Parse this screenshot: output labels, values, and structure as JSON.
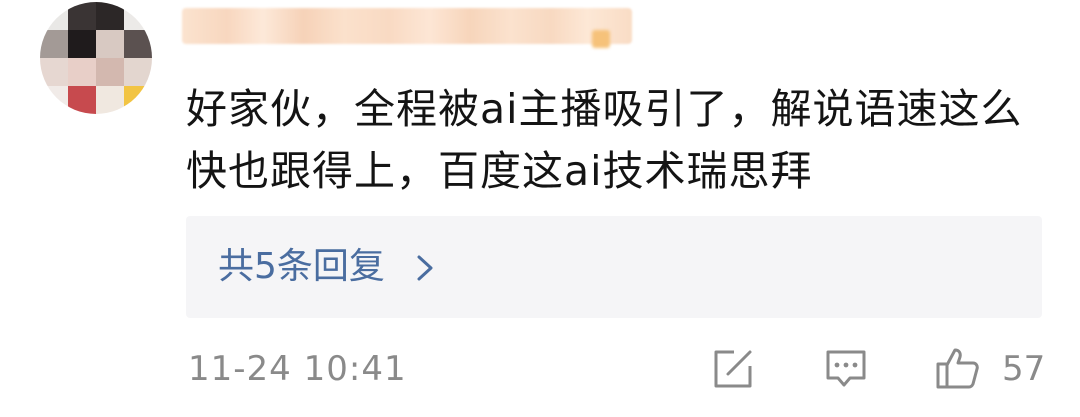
{
  "comment": {
    "text": "好家伙，全程被ai主播吸引了，解说语速这么快也跟得上，百度这ai技术瑞思拜"
  },
  "replies": {
    "label": "共5条回复"
  },
  "footer": {
    "timestamp": "11-24 10:41",
    "like_count": "57"
  },
  "icons": {
    "share": "share-edit-icon",
    "comment": "comment-icon",
    "like": "thumbs-up-icon",
    "chevron": "chevron-right-icon"
  },
  "colors": {
    "reply_link": "#4a6da0",
    "meta_text": "#8a8a8a",
    "replies_bg": "#f5f5f7"
  }
}
